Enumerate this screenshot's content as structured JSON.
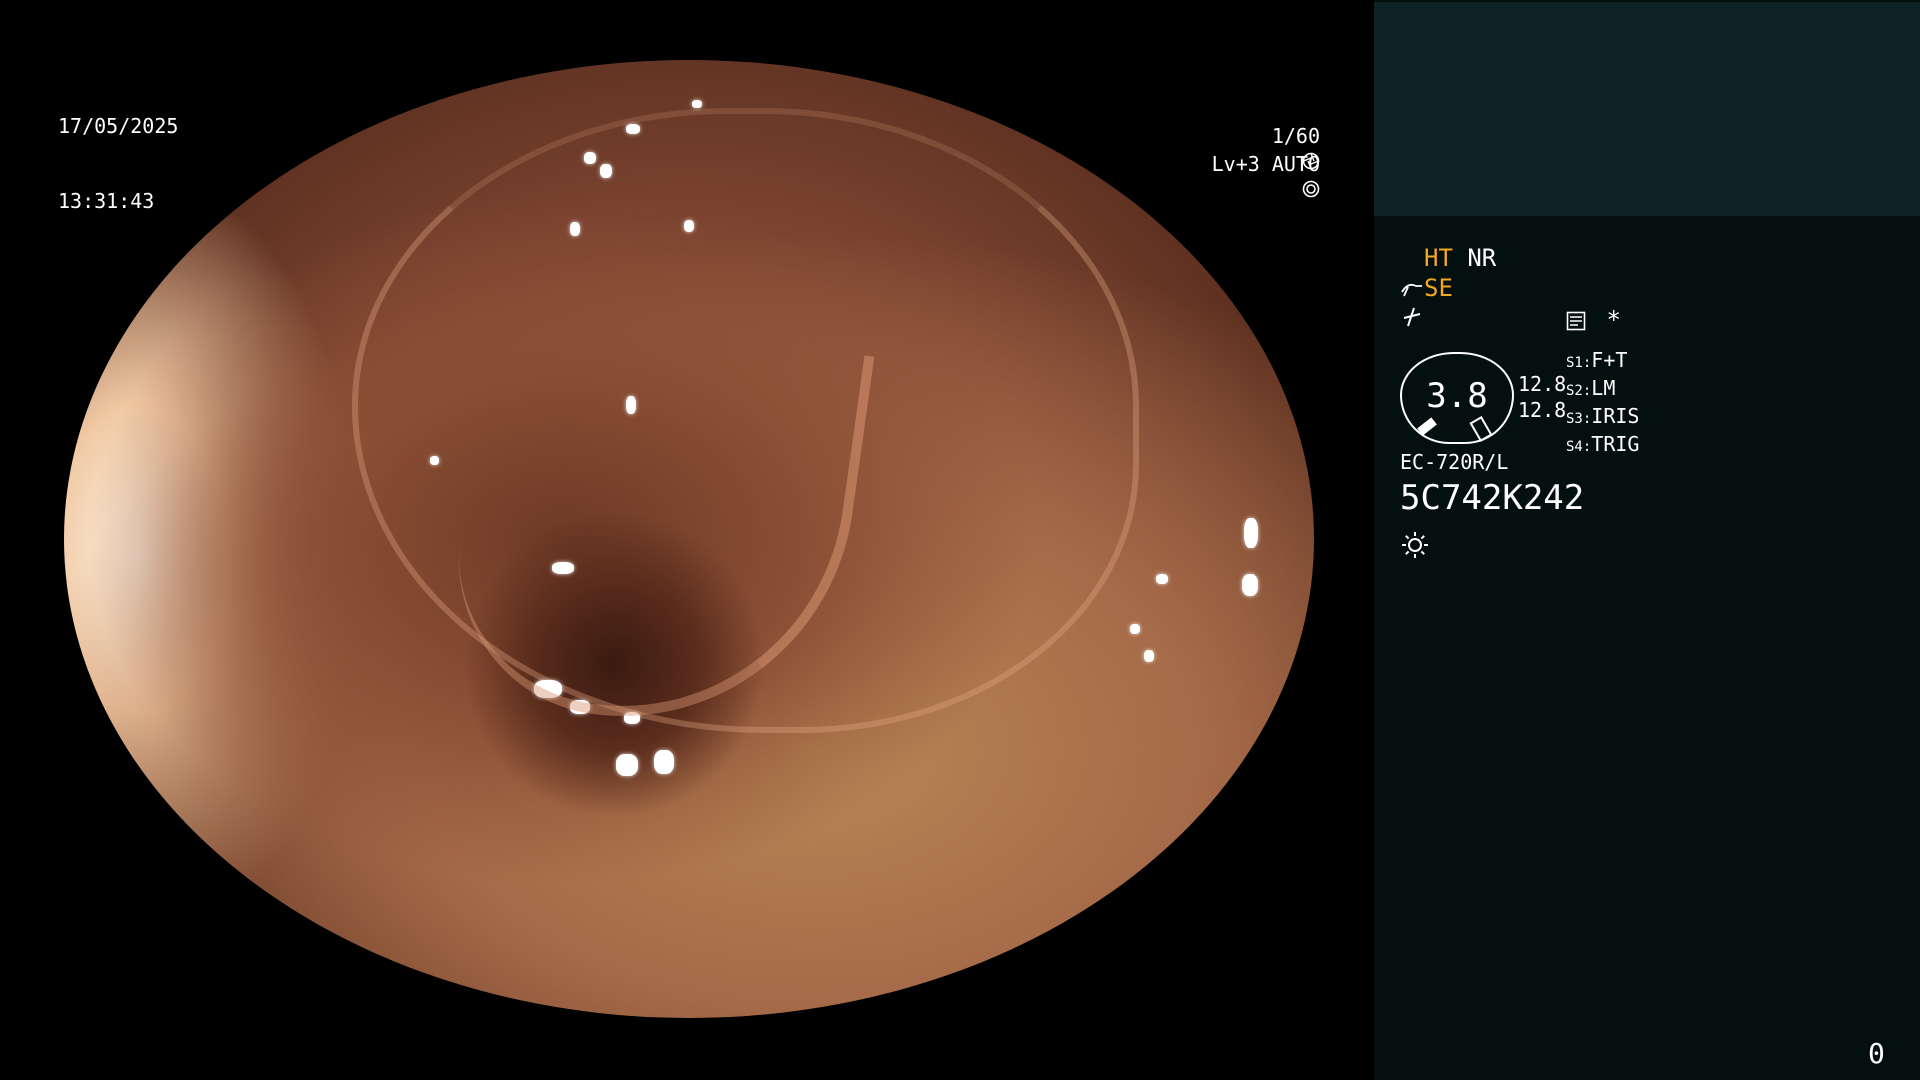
{
  "header": {
    "date": "17/05/2025",
    "time": "13:31:43",
    "shutter": "1/60",
    "iris_mode": "Lv+3 AUTO"
  },
  "status": {
    "ht": "HT",
    "nr": "NR",
    "se": "SE"
  },
  "gauge": {
    "value": "3.8",
    "readout_top": "12.8",
    "readout_bottom": "12.8"
  },
  "switches": [
    {
      "key": "S1",
      "label": "F+T"
    },
    {
      "key": "S2",
      "label": "LM"
    },
    {
      "key": "S3",
      "label": "IRIS"
    },
    {
      "key": "S4",
      "label": "TRIG"
    }
  ],
  "scope": {
    "model": "EC-720R/L",
    "serial": "5C742K242"
  },
  "counter": "0",
  "star": "*",
  "colors": {
    "accent": "#f5a623",
    "panel_bg": "#03100f",
    "panel_top": "#0d2326"
  },
  "icons": [
    "shutter-icon",
    "iris-icon",
    "scope-tip-icon",
    "lightning-icon",
    "memo-icon",
    "light-source-icon"
  ]
}
